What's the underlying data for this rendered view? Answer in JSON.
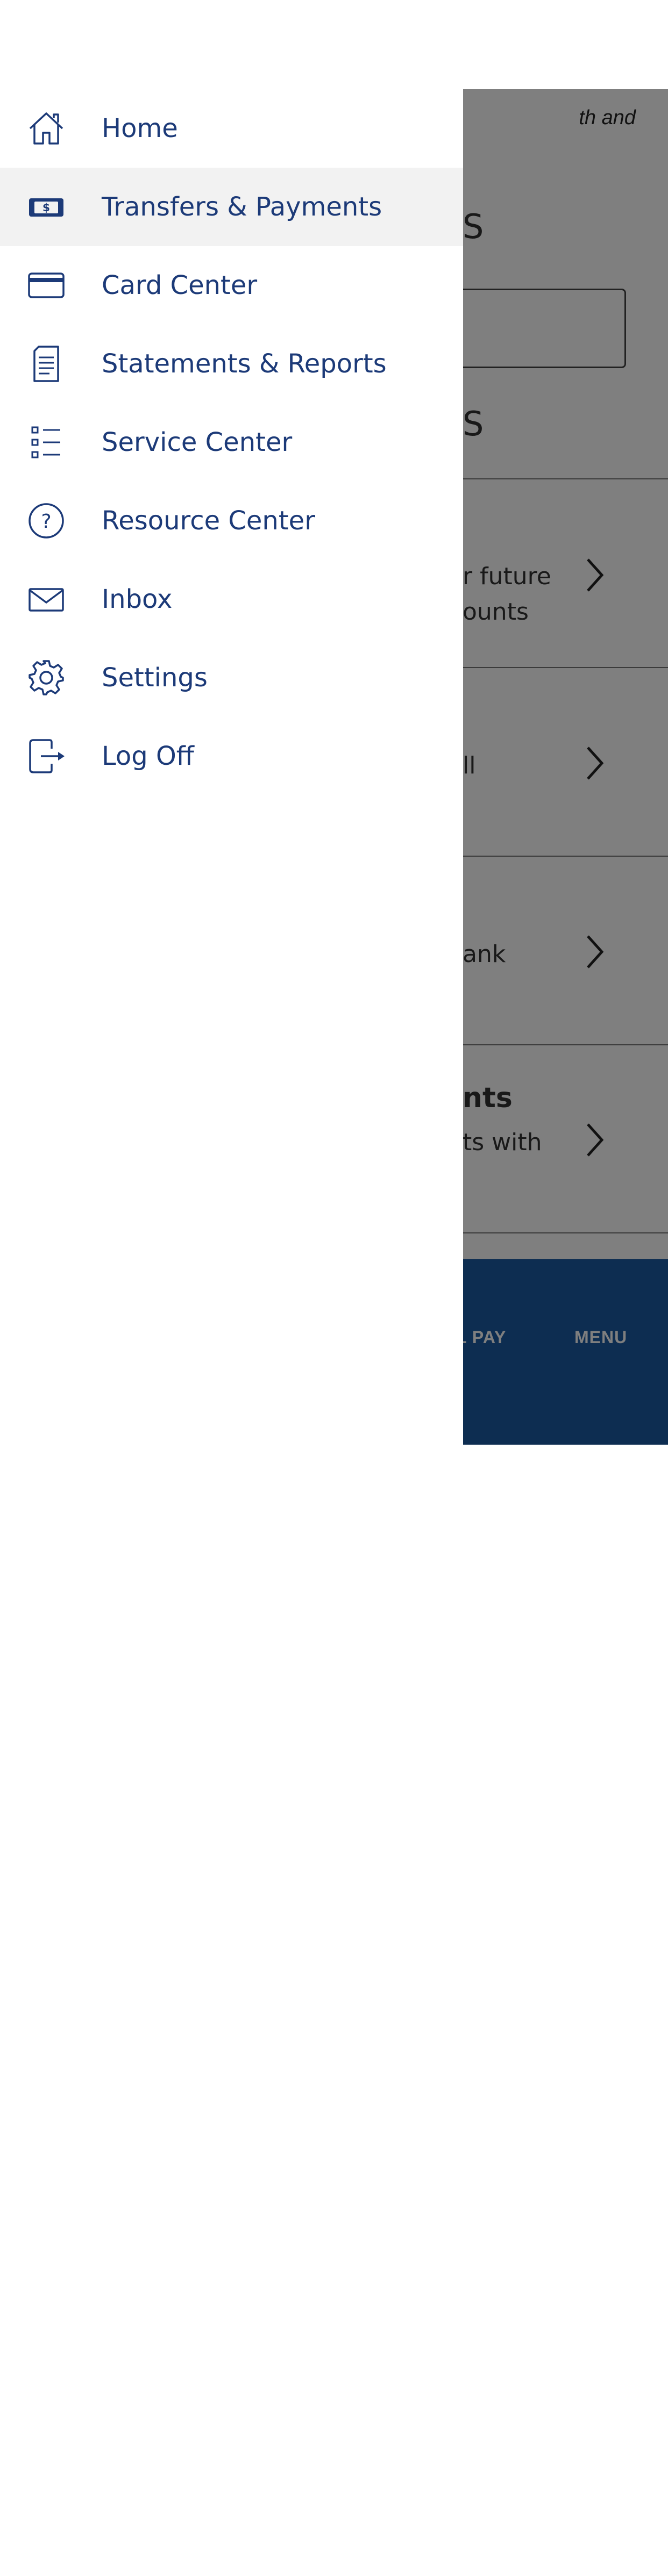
{
  "background_page": {
    "intro_fragment": "th and",
    "heading_1_fragment": "S",
    "heading_2_fragment": "S",
    "rows": [
      {
        "line1": "r future",
        "line2": "ounts"
      },
      {
        "line1": "ll"
      },
      {
        "line1": "ank"
      },
      {
        "title": "nts",
        "line1": "ts with"
      }
    ],
    "tabbar": {
      "tabs": [
        {
          "label": "L PAY",
          "icon": "dollar-icon"
        },
        {
          "label": "MENU",
          "icon": "list-icon"
        }
      ]
    }
  },
  "drawer": {
    "items": [
      {
        "label": "Home",
        "icon": "home-icon",
        "active": false
      },
      {
        "label": "Transfers & Payments",
        "icon": "cash-icon",
        "active": true
      },
      {
        "label": "Card Center",
        "icon": "credit-card-icon",
        "active": false
      },
      {
        "label": "Statements & Reports",
        "icon": "document-icon",
        "active": false
      },
      {
        "label": "Service Center",
        "icon": "checklist-icon",
        "active": false
      },
      {
        "label": "Resource Center",
        "icon": "help-circle-icon",
        "active": false
      },
      {
        "label": "Inbox",
        "icon": "envelope-icon",
        "active": false
      },
      {
        "label": "Settings",
        "icon": "gear-icon",
        "active": false
      },
      {
        "label": "Log Off",
        "icon": "logout-icon",
        "active": false
      }
    ]
  },
  "colors": {
    "drawer_text": "#1c3a78",
    "active_row": "#f2f2f2",
    "tabbar": "#1a5aa3",
    "scrim": "rgba(0,0,0,0.5)"
  }
}
